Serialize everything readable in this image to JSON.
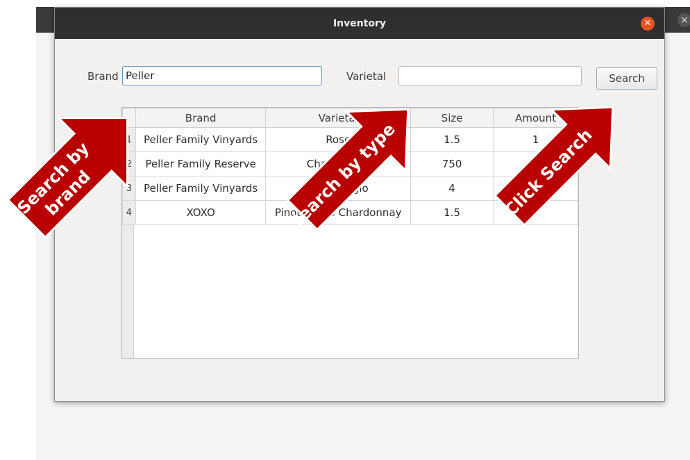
{
  "window": {
    "title": "Inventory"
  },
  "search": {
    "brand_label": "Brand",
    "brand_value": "Peller",
    "varietal_label": "Varietal",
    "varietal_value": "",
    "search_button": "Search"
  },
  "table": {
    "columns": [
      "Brand",
      "Varietal",
      "Size",
      "Amount"
    ],
    "rows": [
      {
        "num": "1",
        "brand": "Peller Family Vinyards",
        "varietal": "Rose",
        "size": "1.5",
        "amount": "1"
      },
      {
        "num": "2",
        "brand": "Peller Family Reserve",
        "varietal": "Chardonnay",
        "size": "750",
        "amount": "1"
      },
      {
        "num": "3",
        "brand": "Peller Family Vinyards",
        "varietal": "Pinot Grigio",
        "size": "4",
        "amount": ""
      },
      {
        "num": "4",
        "brand": "XOXO",
        "varietal": "Pinot Grigio Chardonnay",
        "size": "1.5",
        "amount": ""
      }
    ]
  },
  "annotations": {
    "brand_arrow_line1": "Search by",
    "brand_arrow_line2": "brand",
    "type_arrow": "Search by type",
    "search_arrow": "Click Search",
    "arrow_color": "#b80000"
  }
}
